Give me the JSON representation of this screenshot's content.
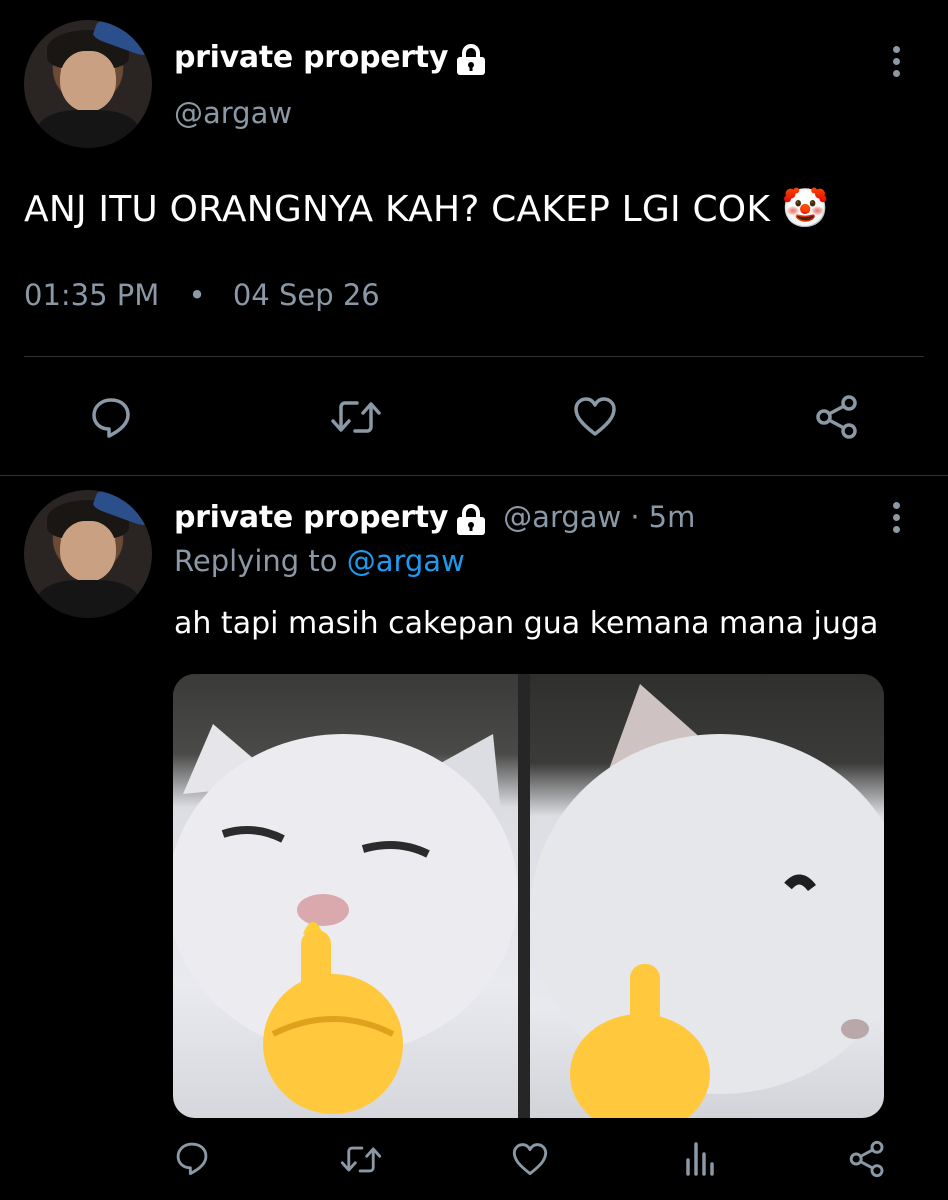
{
  "main_tweet": {
    "name": "private property",
    "handle": "@argaw",
    "text": "ANJ ITU ORANGNYA KAH? CAKEP LGI COK",
    "emoji": "🤡",
    "time": "01:35 PM",
    "separator": "•",
    "date": "04 Sep 26",
    "actions": [
      "comment-icon",
      "retweet-icon",
      "heart-icon",
      "share-icon"
    ]
  },
  "reply_tweet": {
    "name": "private property",
    "handle": "@argaw",
    "dot": "·",
    "time": "5m",
    "replying_label": "Replying to",
    "replying_to": "@argaw",
    "text": "ah tapi masih cakepan gua kemana mana juga",
    "media_description_icon": "cat-meme-image",
    "actions": [
      "comment-icon",
      "retweet-icon",
      "heart-icon",
      "analytics-icon",
      "share-icon"
    ]
  },
  "colors": {
    "background": "#000000",
    "secondary_text": "#8b98a5",
    "mention": "#1d9bf0",
    "divider": "#2f3336"
  }
}
